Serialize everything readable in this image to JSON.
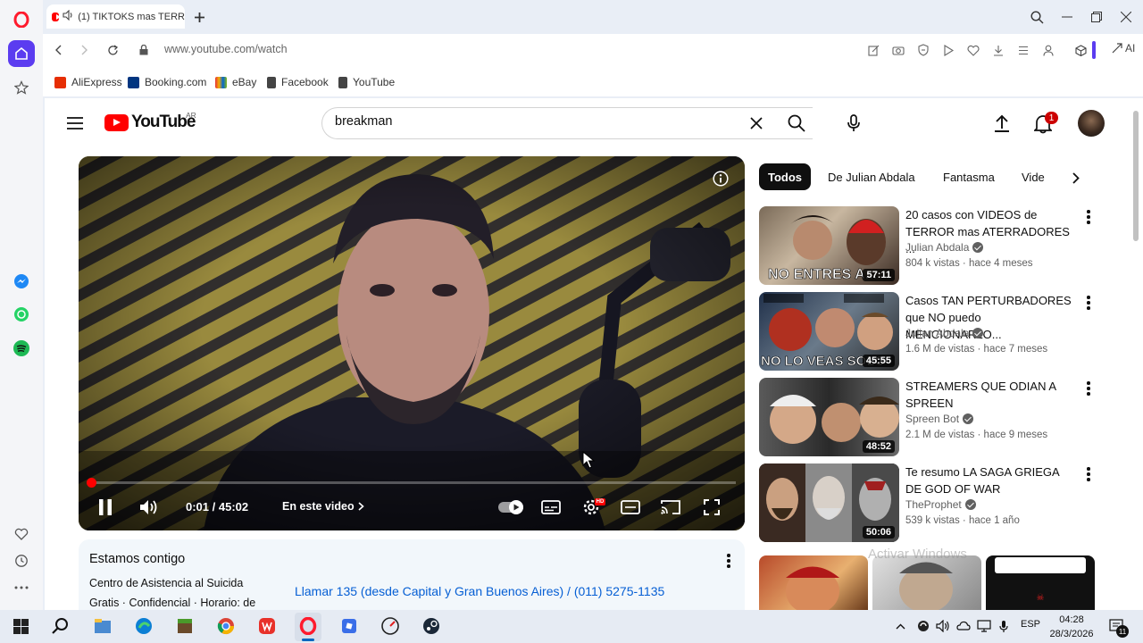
{
  "browser": {
    "tab_title": "(1) TIKTOKS mas TERR",
    "url": "www.youtube.com/watch",
    "ai_label": "AI",
    "bookmarks": [
      {
        "label": "AliExpress",
        "color": "#e62e04"
      },
      {
        "label": "Booking.com",
        "color": "#003580"
      },
      {
        "label": "eBay",
        "color": "#e53238"
      },
      {
        "label": "Facebook",
        "color": "#333333"
      },
      {
        "label": "YouTube",
        "color": "#333333"
      }
    ]
  },
  "youtube": {
    "logo_text": "YouTube",
    "country": "AR",
    "search_value": "breakman",
    "notifications": "1",
    "player": {
      "time": "0:01 / 45:02",
      "chapters_label": "En este video",
      "progress_fraction": 0.0004
    },
    "chips": [
      "Todos",
      "De Julian Abdala",
      "Fantasma",
      "Vide"
    ],
    "info_card": {
      "title": "Estamos contigo",
      "line1": "Centro de Asistencia al Suicida",
      "line2": "Gratis · Confidencial · Horario: de",
      "phone": "Llamar 135 (desde Capital y Gran Buenos Aires) / (011) 5275-1135"
    },
    "recommendations": [
      {
        "title": "20 casos con VIDEOS de TERROR mas ATERRADORES ...",
        "channel": "Julian Abdala",
        "meta": "804 k vistas · hace 4 meses",
        "duration": "57:11",
        "thumb_text": "NO ENTRES A..."
      },
      {
        "title": "Casos TAN PERTURBADORES que NO puedo MENCIONARLO...",
        "channel": "Julian Abdala",
        "meta": "1.6 M de vistas · hace 7 meses",
        "duration": "45:55",
        "thumb_text": "NO LO VEAS SOLO"
      },
      {
        "title": "STREAMERS QUE ODIAN A SPREEN",
        "channel": "Spreen Bot",
        "meta": "2.1 M de vistas · hace 9 meses",
        "duration": "48:52",
        "thumb_text": ""
      },
      {
        "title": "Te resumo LA SAGA GRIEGA DE GOD OF WAR",
        "channel": "TheProphet",
        "meta": "539 k vistas · hace 1 año",
        "duration": "50:06",
        "thumb_text": ""
      }
    ],
    "watermark": "Activar Windows"
  },
  "taskbar": {
    "lang": "ESP",
    "time": "04:28",
    "date": "28/3/2026",
    "notif_count": "11"
  }
}
